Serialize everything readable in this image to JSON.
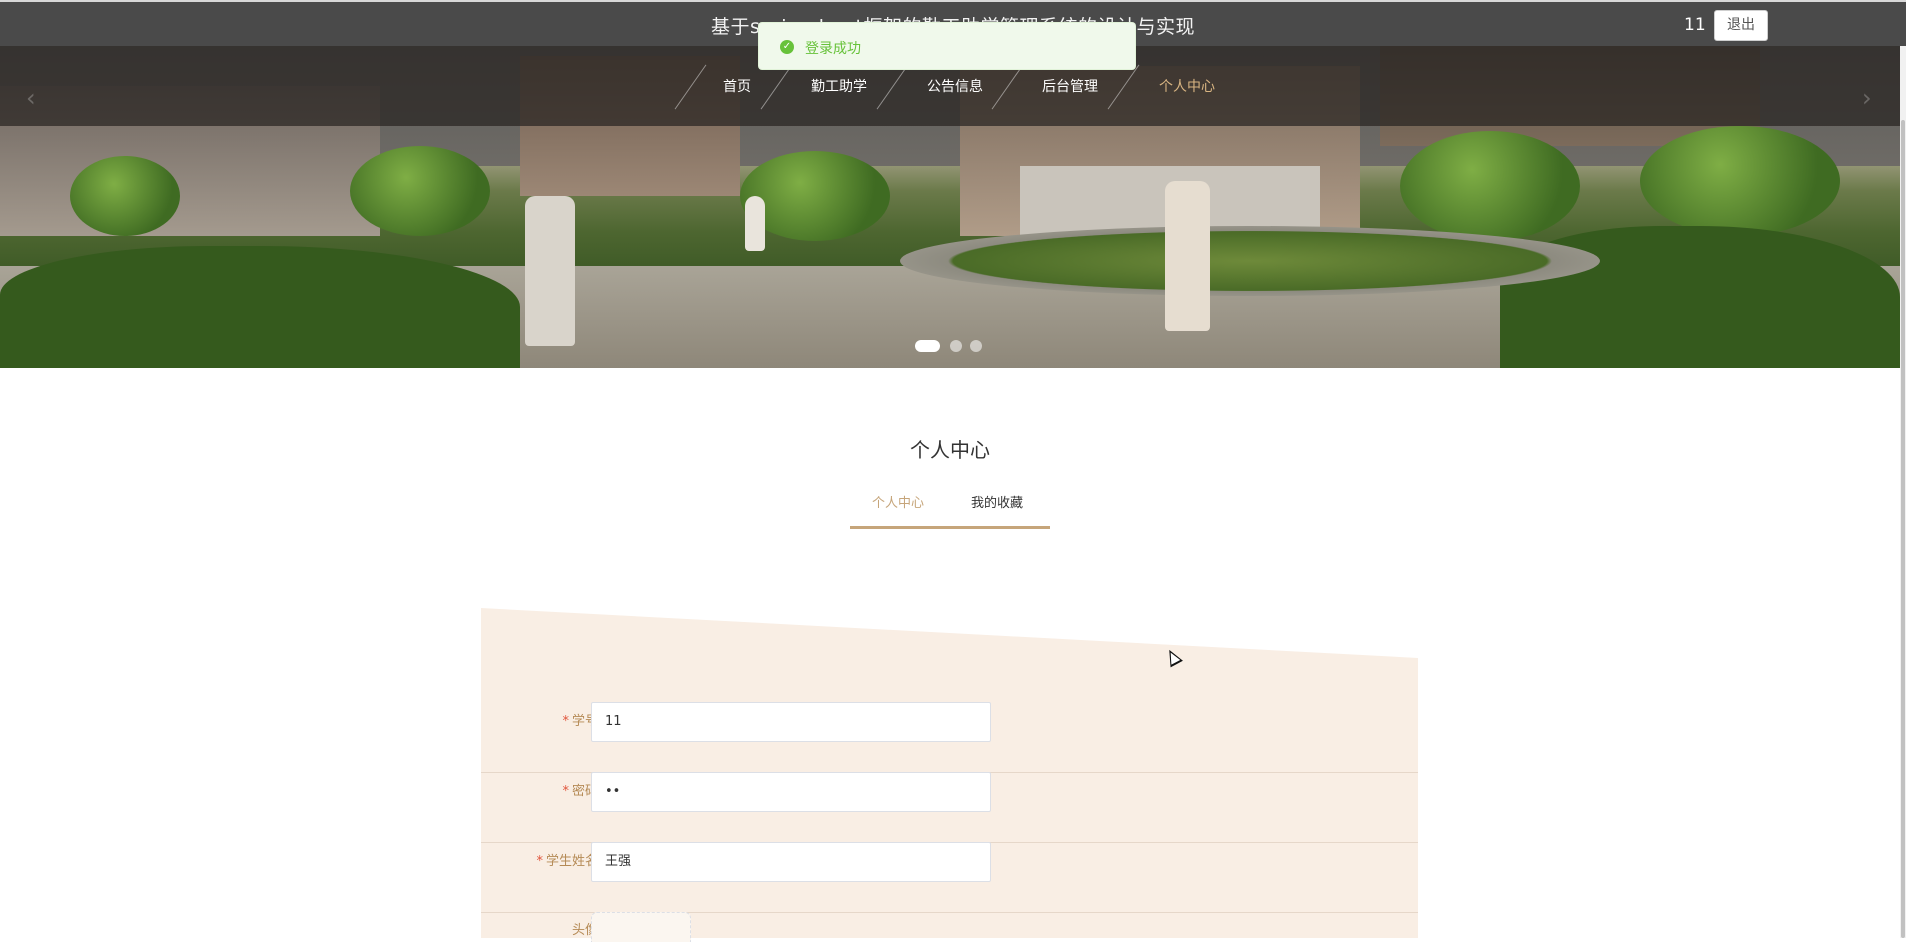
{
  "header": {
    "site_title": "基于spring boot框架的勤工助学管理系统的设计与实现",
    "username": "11",
    "logout_label": "退出"
  },
  "toast": {
    "icon": "check-circle-icon",
    "message": "登录成功",
    "color": "#67c23a"
  },
  "nav": {
    "items": [
      {
        "label": "首页",
        "active": false
      },
      {
        "label": "勤工助学",
        "active": false
      },
      {
        "label": "公告信息",
        "active": false
      },
      {
        "label": "后台管理",
        "active": false
      },
      {
        "label": "个人中心",
        "active": true
      }
    ],
    "active_color": "#d8b482"
  },
  "carousel": {
    "prev_icon": "‹",
    "next_icon": "›",
    "slide_count": 3,
    "active_slide": 1
  },
  "section": {
    "title": "个人中心",
    "tabs": [
      {
        "label": "个人中心",
        "active": true
      },
      {
        "label": "我的收藏",
        "active": false
      }
    ],
    "accent_color": "#c6a57a"
  },
  "form": {
    "fields": [
      {
        "label": "学号",
        "required": true,
        "value": "11"
      },
      {
        "label": "密码",
        "required": true,
        "value": "••"
      },
      {
        "label": "学生姓名",
        "required": true,
        "value": "王强"
      },
      {
        "label": "头像",
        "required": false,
        "value": ""
      }
    ],
    "required_mark": "*"
  }
}
